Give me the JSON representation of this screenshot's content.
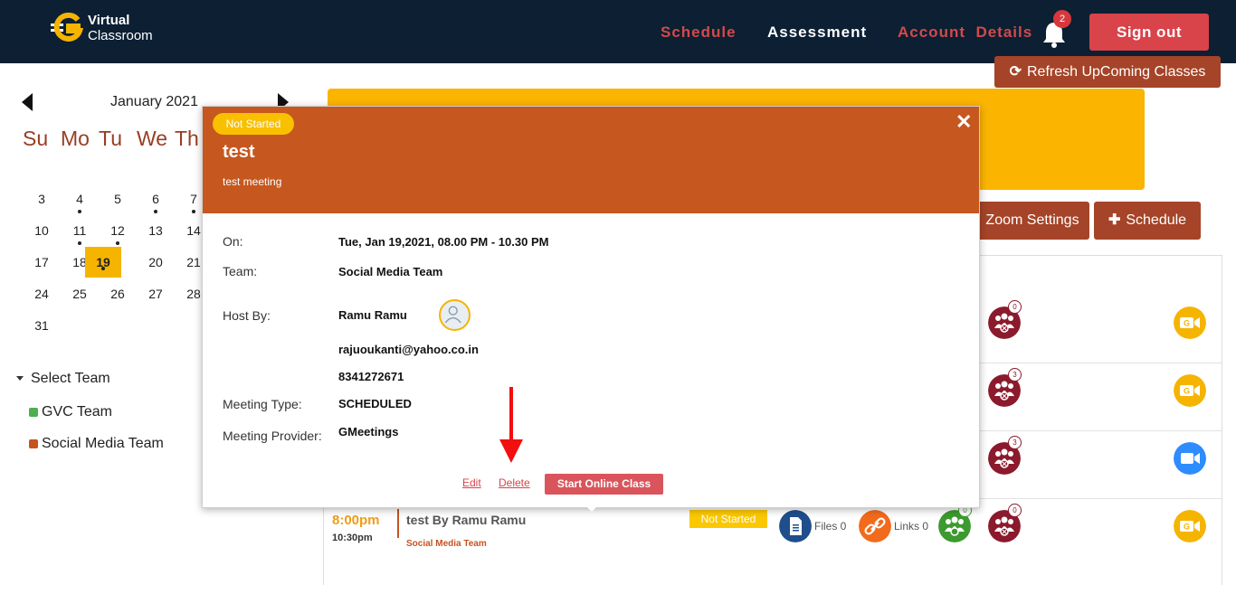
{
  "header": {
    "logo_line1": "Virtual",
    "logo_line2": "Classroom",
    "nav": [
      {
        "label": "Schedule"
      },
      {
        "label": "Assessment"
      },
      {
        "label": "Account  Details"
      }
    ],
    "notification_count": "2",
    "signout_label": "Sign out"
  },
  "calendar": {
    "month_label": "January 2021",
    "weekdays": [
      "Su",
      "Mo",
      "Tu",
      "We",
      "Th"
    ],
    "days": [
      {
        "n": "3"
      },
      {
        "n": "4",
        "dot": true
      },
      {
        "n": "5"
      },
      {
        "n": "6",
        "dot": true
      },
      {
        "n": "7",
        "dot": true
      },
      {
        "n": "10"
      },
      {
        "n": "11",
        "dot": true
      },
      {
        "n": "12",
        "dot": true
      },
      {
        "n": "13"
      },
      {
        "n": "14"
      },
      {
        "n": "17"
      },
      {
        "n": "18"
      },
      {
        "n": "19",
        "dot": true,
        "today": true
      },
      {
        "n": "20"
      },
      {
        "n": "21"
      },
      {
        "n": "24"
      },
      {
        "n": "25"
      },
      {
        "n": "26"
      },
      {
        "n": "27"
      },
      {
        "n": "28"
      },
      {
        "n": "31"
      }
    ]
  },
  "teams": {
    "heading": "Select Team",
    "items": [
      {
        "label": "GVC Team",
        "color": "#4caf50"
      },
      {
        "label": "Social Media Team",
        "color": "#c6531f"
      }
    ]
  },
  "toolbar": {
    "refresh_label": "Refresh UpComing Classes",
    "zoom_label": "Zoom Settings",
    "schedule_label": "Schedule"
  },
  "rows": [
    {
      "attendees": "0",
      "provider": "gmeetings"
    },
    {
      "attendees": "3",
      "provider": "gmeetings"
    },
    {
      "attendees": "3",
      "provider": "zoom"
    },
    {
      "attendees": "0",
      "provider": "gmeetings"
    }
  ],
  "last_row": {
    "start_time": "8:00pm",
    "end_time": "10:30pm",
    "title": "test By Ramu Ramu",
    "team": "Social Media Team",
    "status": "Not Started",
    "files_label": "Files 0",
    "links_label": "Links 0",
    "present_count": "0"
  },
  "popup": {
    "status": "Not Started",
    "title": "test",
    "subtitle": "test meeting",
    "fields": {
      "on_label": "On:",
      "on_value": "Tue, Jan 19,2021, 08.00 PM - 10.30 PM",
      "team_label": "Team:",
      "team_value": "Social Media Team",
      "host_label": "Host By:",
      "host_value": "Ramu Ramu",
      "email_value": "rajuoukanti@yahoo.co.in",
      "phone_value": "8341272671",
      "type_label": "Meeting Type:",
      "type_value": "SCHEDULED",
      "provider_label": "Meeting Provider:",
      "provider_value": "GMeetings"
    },
    "edit_label": "Edit",
    "delete_label": "Delete",
    "start_label": "Start Online Class",
    "close_glyph": "✕"
  },
  "colors": {
    "header_bg": "#0c1f33",
    "accent_brown": "#a54428",
    "popup_head": "#c6571f",
    "yellow": "#fbb400",
    "annotation_arrow": "#f10f0f"
  }
}
